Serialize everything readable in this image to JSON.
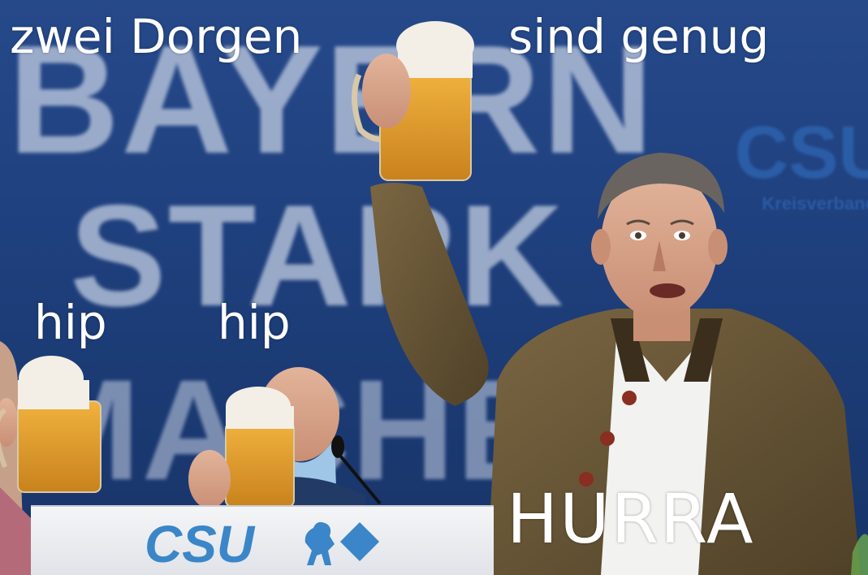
{
  "captions": {
    "top_left": "zwei Dorgen",
    "top_right": "sind genug",
    "hip_left": "hip",
    "hip_right": "hip",
    "bottom_right": "HURRA"
  },
  "backdrop": {
    "words": [
      "BAYERN",
      "STARK",
      "MACHEN"
    ],
    "party_right": "CSU",
    "party_right_sub": "Kreisverband"
  },
  "lectern": {
    "logo": "CSU"
  },
  "colors": {
    "backdrop_blue": "#1f3e7a",
    "csu_blue": "#3a86c8",
    "beer_gold": "#e0a432",
    "jacket_olive": "#6b5a3a"
  }
}
